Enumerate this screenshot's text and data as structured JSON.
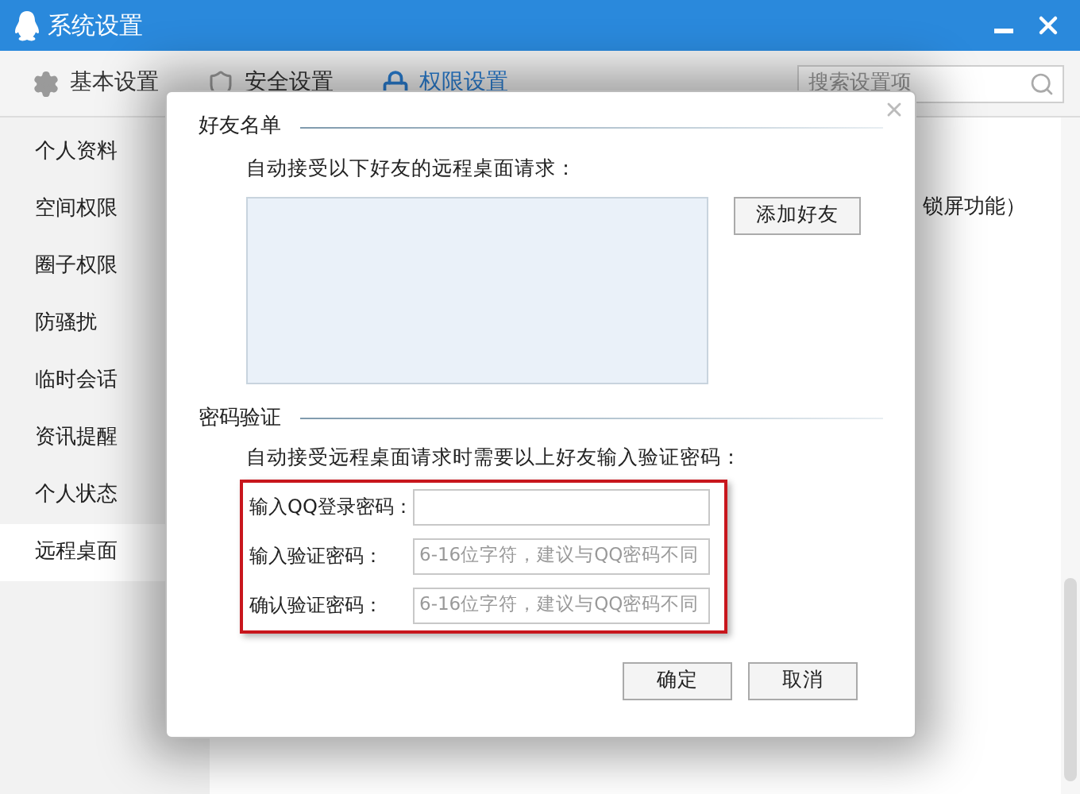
{
  "window": {
    "title": "系统设置"
  },
  "tabs": [
    {
      "label": "基本设置",
      "kind": "gear",
      "selected": false
    },
    {
      "label": "安全设置",
      "kind": "shield",
      "selected": false
    },
    {
      "label": "权限设置",
      "kind": "lock",
      "selected": true
    }
  ],
  "search": {
    "placeholder": "搜索设置项"
  },
  "sidebar": {
    "items": [
      {
        "label": "个人资料",
        "selected": false
      },
      {
        "label": "空间权限",
        "selected": false
      },
      {
        "label": "圈子权限",
        "selected": false
      },
      {
        "label": "防骚扰",
        "selected": false
      },
      {
        "label": "临时会话",
        "selected": false
      },
      {
        "label": "资讯提醒",
        "selected": false
      },
      {
        "label": "个人状态",
        "selected": false
      },
      {
        "label": "远程桌面",
        "selected": true
      }
    ]
  },
  "content": {
    "text": "锁屏功能）"
  },
  "dialog": {
    "friend_list": {
      "title": "好友名单",
      "description": "自动接受以下好友的远程桌面请求：",
      "add_button": "添加好友"
    },
    "password": {
      "title": "密码验证",
      "description": "自动接受远程桌面请求时需要以上好友输入验证密码：",
      "highlighted": true,
      "fields": [
        {
          "label": "输入QQ登录密码："
        },
        {
          "label": "输入验证密码：",
          "placeholder": "6-16位字符，建议与QQ密码不同"
        },
        {
          "label": "确认验证密码：",
          "placeholder": "6-16位字符，建议与QQ密码不同"
        }
      ]
    },
    "buttons": [
      "确定",
      "取消"
    ]
  }
}
